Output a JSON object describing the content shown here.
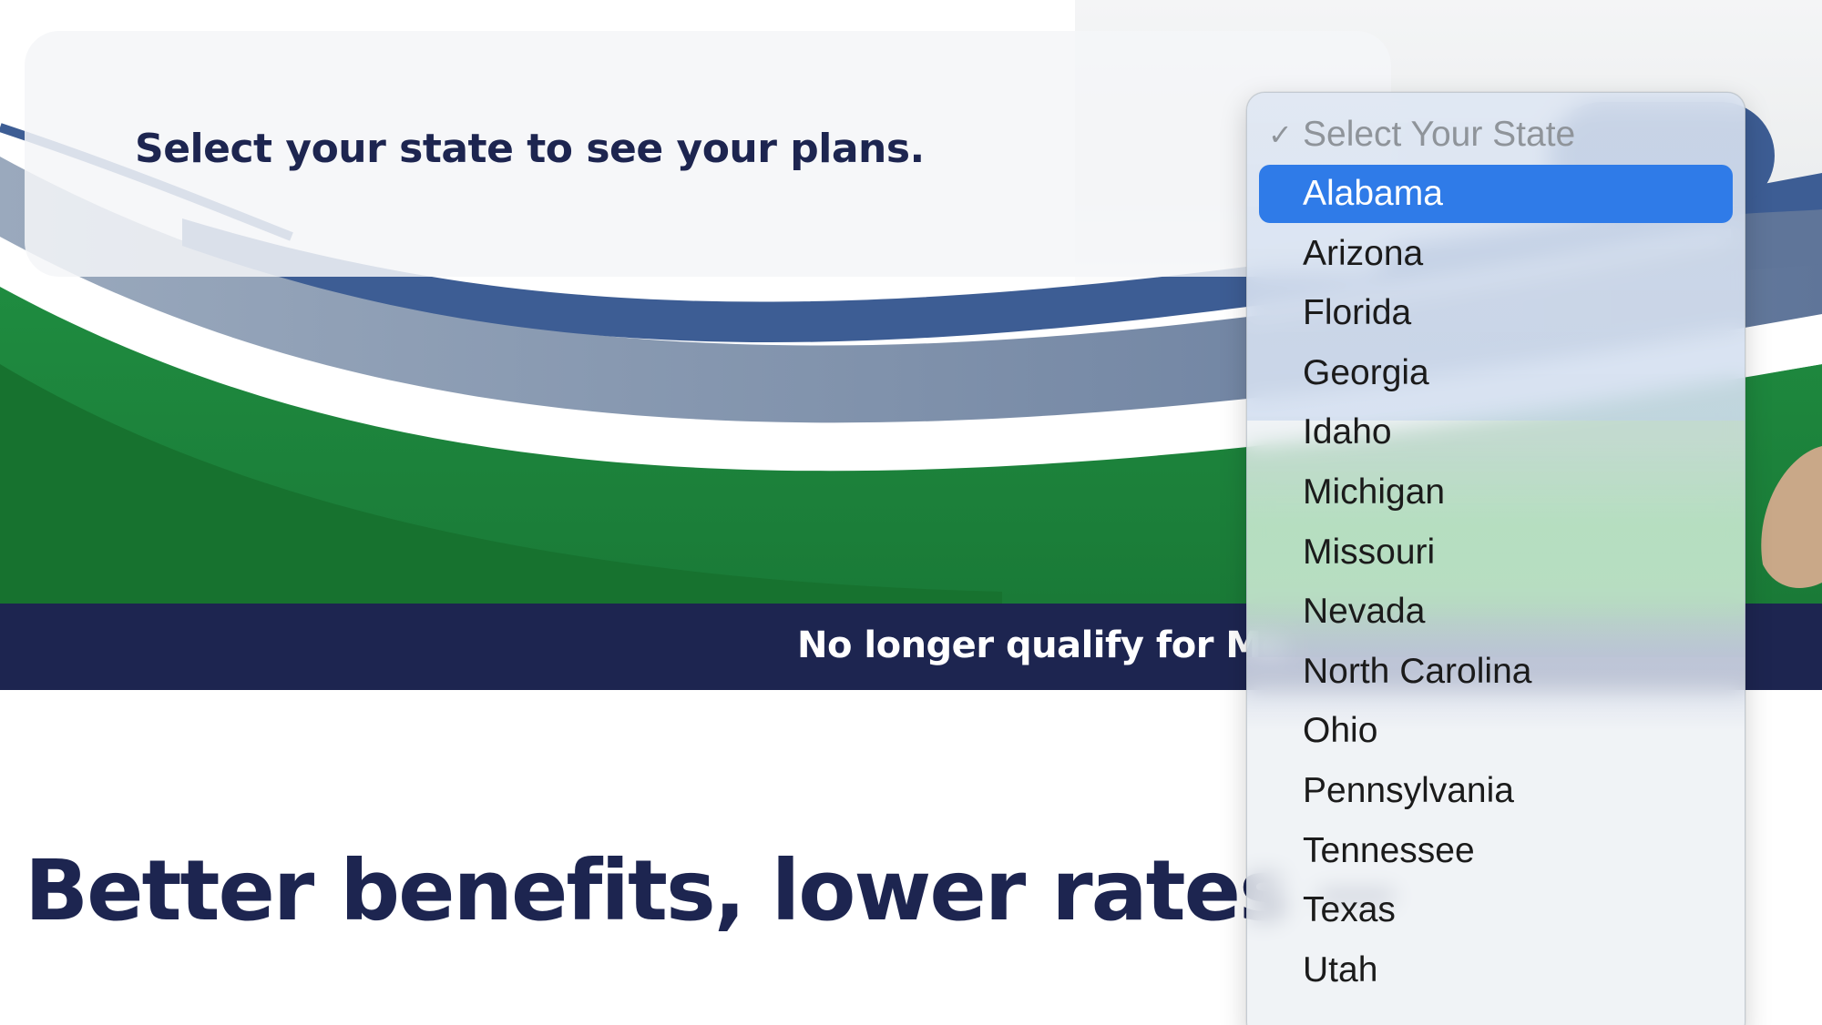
{
  "selector": {
    "prompt": "Select your state to see your plans."
  },
  "dropdown": {
    "placeholder": "Select Your State",
    "checkmark": "✓",
    "highlighted": "Alabama",
    "options": [
      "Alabama",
      "Arizona",
      "Florida",
      "Georgia",
      "Idaho",
      "Michigan",
      "Missouri",
      "Nevada",
      "North Carolina",
      "Ohio",
      "Pennsylvania",
      "Tennessee",
      "Texas",
      "Utah"
    ]
  },
  "banner": {
    "text": "No longer qualify for Me"
  },
  "headline": {
    "text": "Better benefits, lower rates —"
  },
  "colors": {
    "navy": "#1d2550",
    "wave_blue": "#3d5d94",
    "wave_green": "#1e8a3e",
    "highlight": "#2f7be8"
  }
}
